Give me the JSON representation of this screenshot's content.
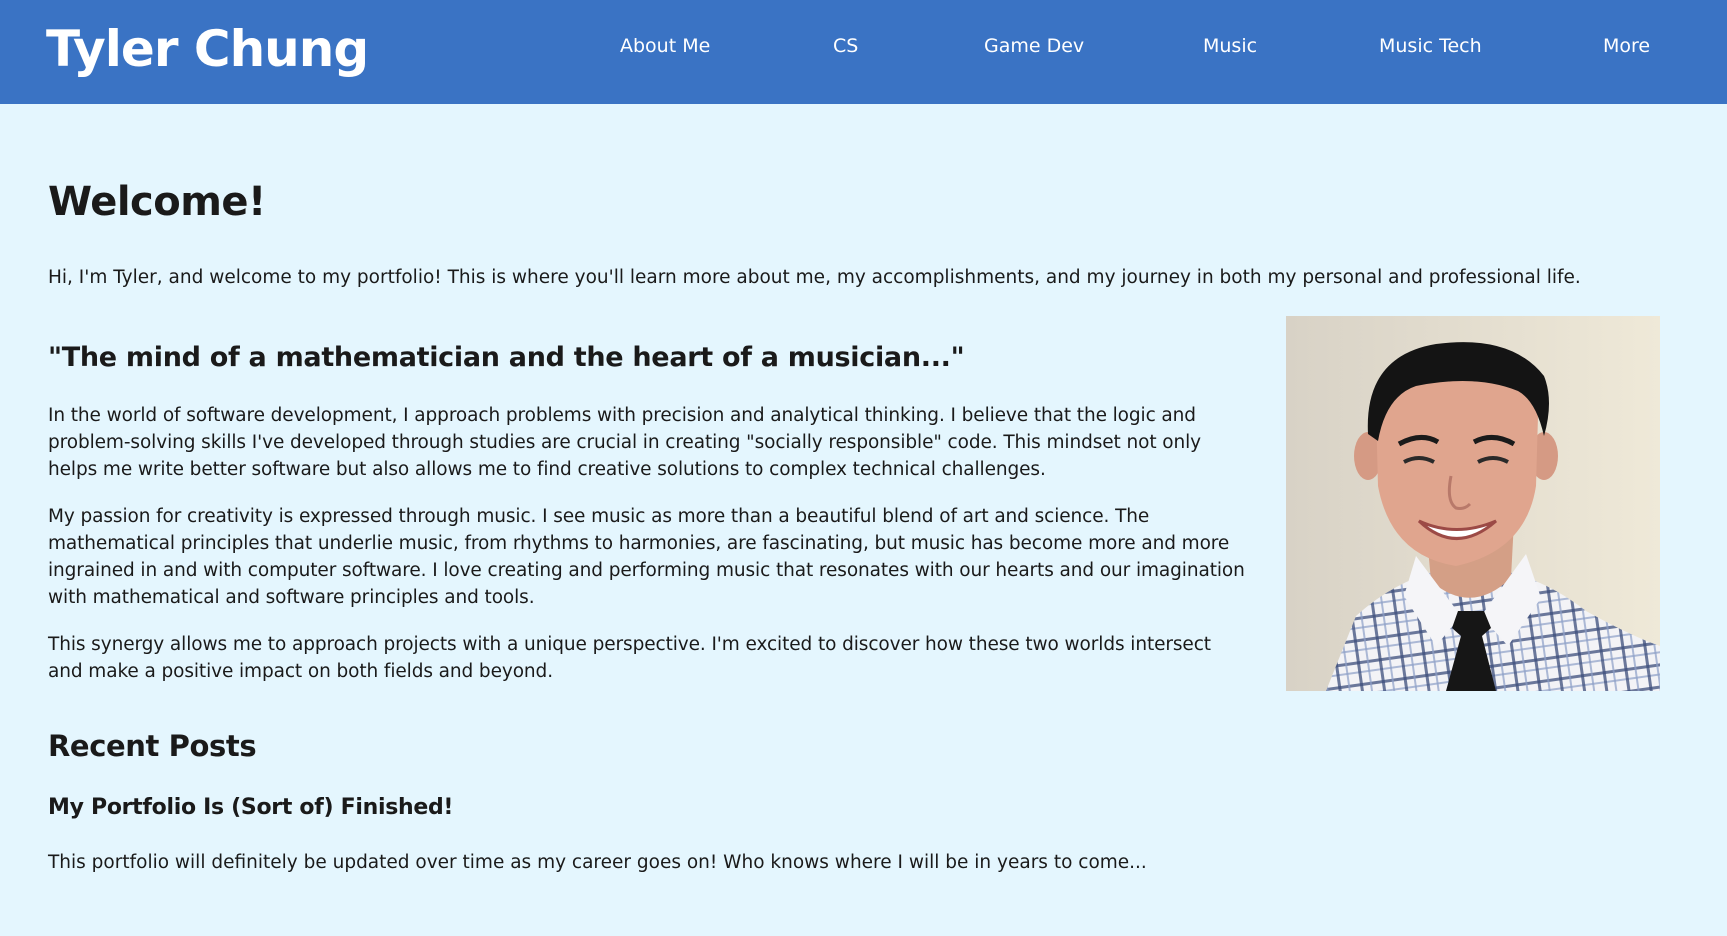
{
  "header": {
    "site_title": "Tyler Chung",
    "nav": [
      {
        "label": "About Me"
      },
      {
        "label": "CS"
      },
      {
        "label": "Game Dev"
      },
      {
        "label": "Music"
      },
      {
        "label": "Music Tech"
      },
      {
        "label": "More"
      }
    ]
  },
  "main": {
    "welcome_heading": "Welcome!",
    "intro": "Hi, I'm Tyler, and welcome to my portfolio! This is where you'll learn more about me, my accomplishments, and my journey in both my personal and professional life.",
    "quote": "\"The mind of a mathematician and the heart of a musician...\"",
    "paragraphs": [
      "In the world of software development, I approach problems with precision and analytical thinking. I believe that the logic and problem-solving skills I've developed through studies are crucial in creating \"socially responsible\" code. This mindset not only helps me write better software but also allows me to find creative solutions to complex technical challenges.",
      "My passion for creativity is expressed through music. I see music as more than a beautiful blend of art and science. The mathematical principles that underlie music, from rhythms to harmonies, are fascinating, but music has become more and more ingrained in and with computer software. I love creating and performing music that resonates with our hearts and our imagination with mathematical and software principles and tools.",
      "This synergy allows me to approach projects with a unique perspective. I'm excited to discover how these two worlds intersect and make a positive impact on both fields and beyond."
    ]
  },
  "recent_posts": {
    "heading": "Recent Posts",
    "posts": [
      {
        "title": "My Portfolio Is (Sort of) Finished!",
        "excerpt": "This portfolio will definitely be updated over time as my career goes on! Who knows where I will be in years to come..."
      }
    ]
  },
  "colors": {
    "header_bg": "#3a73c4",
    "page_bg": "#e4f6fe",
    "text": "#1a1a1a",
    "header_text": "#ffffff"
  }
}
